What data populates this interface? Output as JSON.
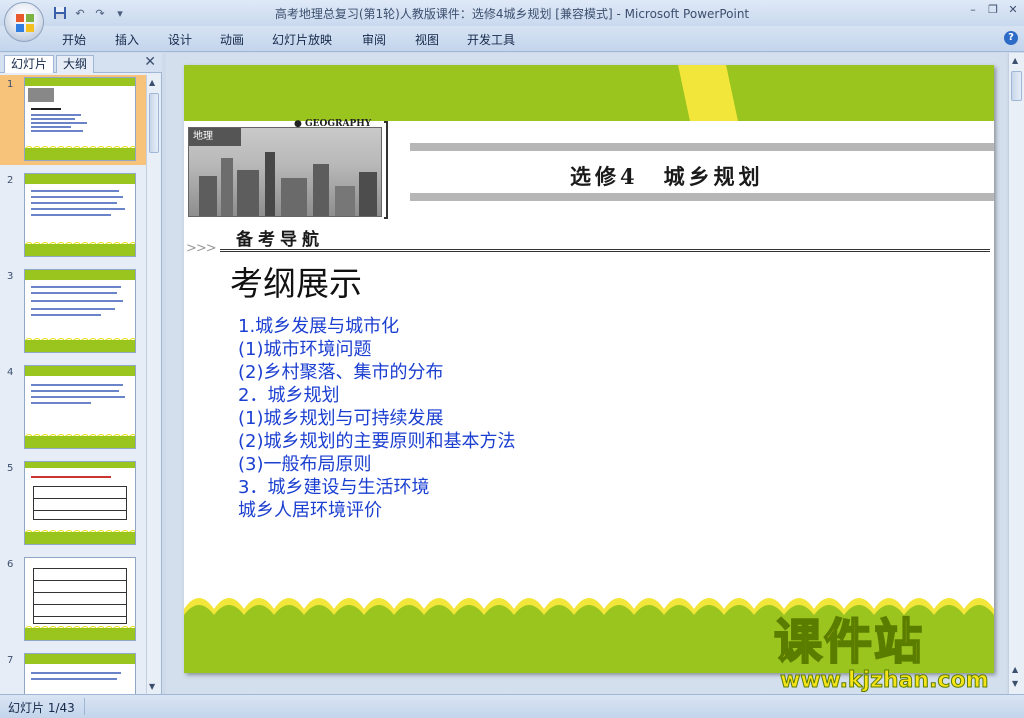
{
  "window": {
    "title": "高考地理总复习(第1轮)人教版课件：选修4城乡规划 [兼容模式] - Microsoft PowerPoint",
    "minimize": "–",
    "restore": "❐",
    "close": "✕"
  },
  "ribbon": {
    "tabs": [
      "开始",
      "插入",
      "设计",
      "动画",
      "幻灯片放映",
      "审阅",
      "视图",
      "开发工具"
    ],
    "help": "?"
  },
  "left_pane": {
    "tabs": [
      "幻灯片",
      "大纲"
    ],
    "close": "✕",
    "thumb_numbers": [
      "1",
      "2",
      "3",
      "4",
      "5",
      "6",
      "7"
    ],
    "selected_index": 1
  },
  "slide": {
    "photo_tag": "地理",
    "geo_label": "● GEOGRAPHY",
    "header": "选修4　城乡规划",
    "nav_arrows": ">>>",
    "nav_label": "备考导航",
    "title": "考纲展示",
    "lines": [
      "1.城乡发展与城市化",
      "(1)城市环境问题",
      "(2)乡村聚落、集市的分布",
      "2．城乡规划",
      "(1)城乡规划与可持续发展",
      "(2)城乡规划的主要原则和基本方法",
      "(3)一般布局原则",
      "3．城乡建设与生活环境",
      "城乡人居环境评价"
    ]
  },
  "watermark": {
    "text": "课件站",
    "url": "www.kjzhan.com"
  },
  "status": {
    "slide_counter": "幻灯片 1/43"
  },
  "colors": {
    "green": "#9ac41e",
    "yellow": "#f3e63a",
    "text_blue": "#1b3fd0"
  }
}
